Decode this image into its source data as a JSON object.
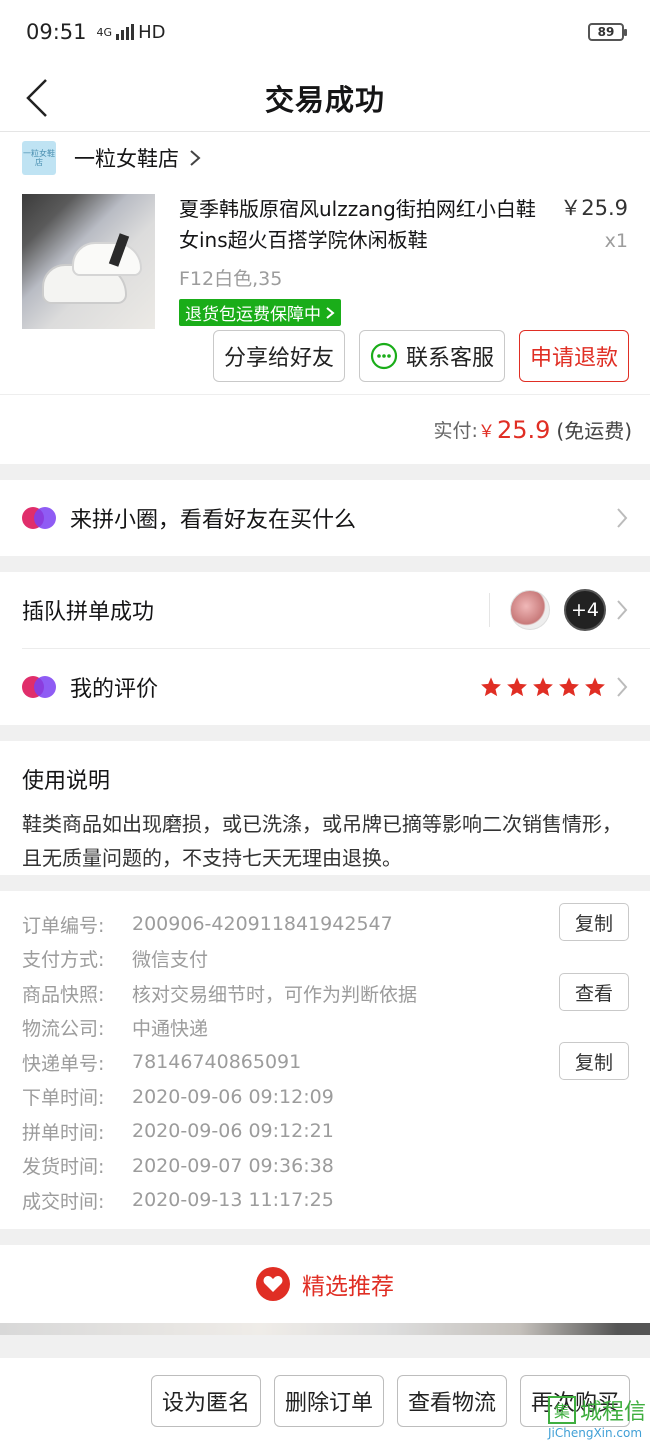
{
  "status": {
    "time": "09:51",
    "network": "4G",
    "hd": "HD",
    "battery": "89"
  },
  "navbar": {
    "title": "交易成功"
  },
  "shop": {
    "name": "一粒女鞋店",
    "logo_text": "一粒女鞋店"
  },
  "goods": {
    "title": "夏季韩版原宿风ulzzang街拍网红小白鞋女ins超火百搭学院休闲板鞋",
    "spec": "F12白色,35",
    "badge": "退货包运费保障中",
    "price": "￥25.9",
    "quantity": "x1"
  },
  "actions": {
    "share": "分享给好友",
    "contact": "联系客服",
    "refund": "申请退款"
  },
  "payment": {
    "label": "实付:",
    "currency": "￥",
    "amount": "25.9",
    "shipping": "(免运费)"
  },
  "circle": {
    "label": "来拼小圈，看看好友在买什么"
  },
  "group": {
    "label": "插队拼单成功",
    "extra": "+4"
  },
  "review": {
    "label": "我的评价",
    "rating": 5,
    "max": 5
  },
  "note": {
    "title": "使用说明",
    "body": "鞋类商品如出现磨损，或已洗涤，或吊牌已摘等影响二次销售情形，且无质量问题的，不支持七天无理由退换。"
  },
  "order": {
    "rows": [
      {
        "key": "订单编号:",
        "value": "200906-420911841942547"
      },
      {
        "key": "支付方式:",
        "value": "微信支付"
      },
      {
        "key": "商品快照:",
        "value": "核对交易细节时，可作为判断依据"
      },
      {
        "key": "物流公司:",
        "value": "中通快递"
      },
      {
        "key": "快递单号:",
        "value": "78146740865091"
      },
      {
        "key": "下单时间:",
        "value": "2020-09-06 09:12:09"
      },
      {
        "key": "拼单时间:",
        "value": "2020-09-06 09:12:21"
      },
      {
        "key": "发货时间:",
        "value": "2020-09-07 09:36:38"
      },
      {
        "key": "成交时间:",
        "value": "2020-09-13 11:17:25"
      }
    ],
    "copy_label": "复制",
    "view_label": "查看"
  },
  "recommend": {
    "label": "精选推荐"
  },
  "bottom": {
    "anonymous": "设为匿名",
    "delete": "删除订单",
    "logistics": "查看物流",
    "rebuy": "再次购买"
  },
  "watermark": {
    "brand": "城程信",
    "url": "JiChengXin.com"
  },
  "colors": {
    "accent": "#e02e24",
    "green": "#1aad19",
    "purple": "#7b3ff2"
  }
}
